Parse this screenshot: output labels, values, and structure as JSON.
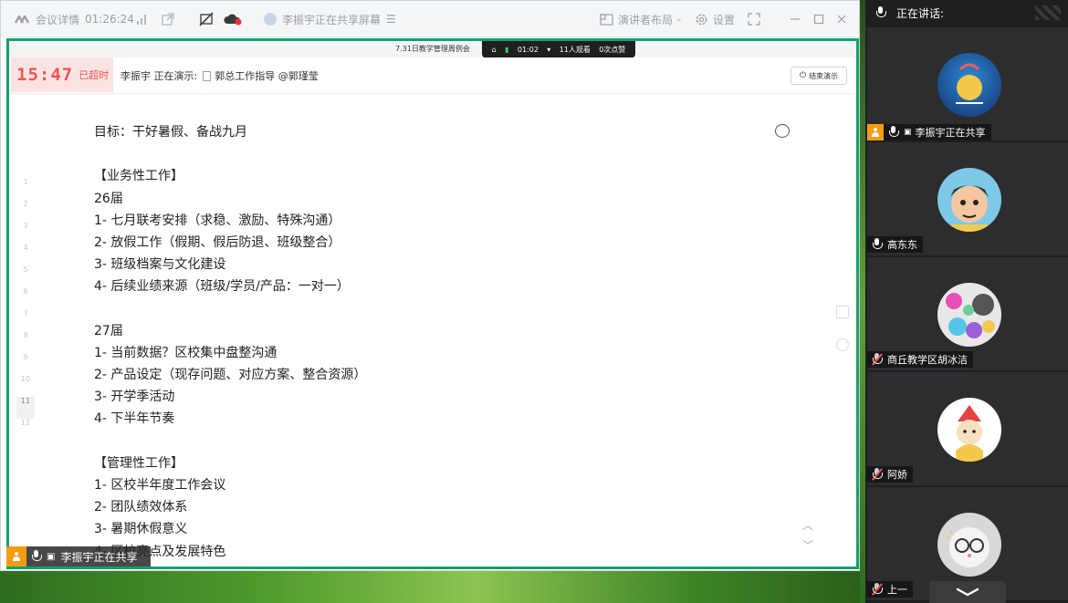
{
  "titlebar": {
    "meeting_details": "会议详情",
    "elapsed": "01:26:24",
    "sharing_status": "李振宇正在共享屏幕",
    "layout_label": "演讲者布局",
    "settings_label": "设置"
  },
  "share": {
    "meeting_title": "7.31日教学管理周例会",
    "rec_time": "01:02",
    "viewers": "11人观看",
    "likes": "0次点赞",
    "timer": "15:47",
    "timer_status": "已超时",
    "presenter_text": "李振宇 正在演示:",
    "doc_title": "郭总工作指导 @郭瑾莹",
    "end_button": "结束演示"
  },
  "line_numbers": [
    "1",
    "2",
    "3",
    "4",
    "5",
    "6",
    "7",
    "8",
    "9",
    "10",
    "11",
    "12"
  ],
  "document": {
    "lines": [
      "目标：干好暑假、备战九月",
      "",
      "【业务性工作】",
      "26届",
      "1- 七月联考安排（求稳、激励、特殊沟通）",
      "2- 放假工作（假期、假后防退、班级整合）",
      "3- 班级档案与文化建设",
      "4- 后续业绩来源（班级/学员/产品：一对一）",
      "",
      "27届",
      "1- 当前数据？区校集中盘整沟通",
      "2- 产品设定（现存问题、对应方案、整合资源）",
      "3- 开学季活动",
      "4- 下半年节奏",
      "",
      "【管理性工作】",
      "1- 区校半年度工作会议",
      "2- 团队绩效体系",
      "3- 暑期休假意义",
      "4- 区校亮点及发展特色"
    ]
  },
  "share_tag": "李振宇正在共享",
  "panel": {
    "header": "正在讲话:",
    "participants": [
      {
        "name": "李振宇正在共享",
        "muted": false
      },
      {
        "name": "高东东",
        "muted": false
      },
      {
        "name": "商丘教学区胡冰洁",
        "muted": true
      },
      {
        "name": "阿娇",
        "muted": true
      },
      {
        "name": "上一",
        "muted": true
      }
    ]
  },
  "colors": {
    "share_border": "#14a06b",
    "timer_red": "#ee5555",
    "accent_orange": "#f39c12"
  }
}
